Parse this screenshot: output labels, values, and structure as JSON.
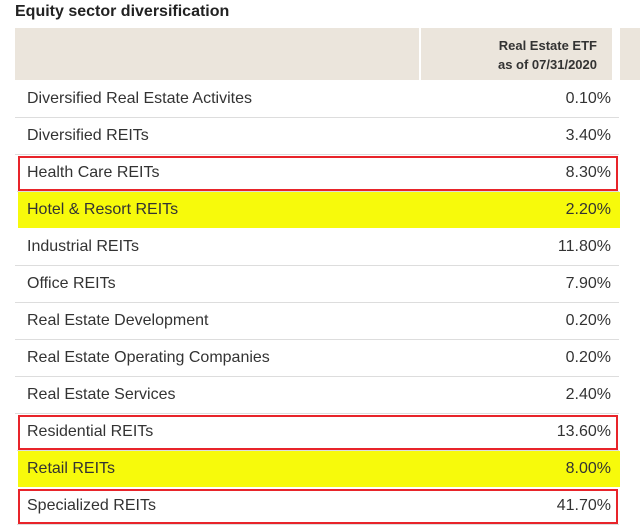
{
  "title": "Equity sector diversification",
  "header": {
    "line1": "Real Estate ETF",
    "line2": "as of 07/31/2020"
  },
  "rows": [
    {
      "name": "Diversified Real Estate Activites",
      "value": "0.10%",
      "mark": "none"
    },
    {
      "name": "Diversified REITs",
      "value": "3.40%",
      "mark": "none"
    },
    {
      "name": "Health Care REITs",
      "value": "8.30%",
      "mark": "red"
    },
    {
      "name": "Hotel & Resort REITs",
      "value": "2.20%",
      "mark": "yellow"
    },
    {
      "name": "Industrial REITs",
      "value": "11.80%",
      "mark": "none"
    },
    {
      "name": "Office REITs",
      "value": "7.90%",
      "mark": "none"
    },
    {
      "name": "Real Estate Development",
      "value": "0.20%",
      "mark": "none"
    },
    {
      "name": "Real Estate Operating Companies",
      "value": "0.20%",
      "mark": "none"
    },
    {
      "name": "Real Estate Services",
      "value": "2.40%",
      "mark": "none"
    },
    {
      "name": "Residential REITs",
      "value": "13.60%",
      "mark": "red"
    },
    {
      "name": "Retail REITs",
      "value": "8.00%",
      "mark": "yellow"
    },
    {
      "name": "Specialized REITs",
      "value": "41.70%",
      "mark": "red"
    }
  ],
  "colors": {
    "red_box": "#e8242a",
    "highlight": "#f7fa0b",
    "header_bg": "#ebe5dc"
  }
}
